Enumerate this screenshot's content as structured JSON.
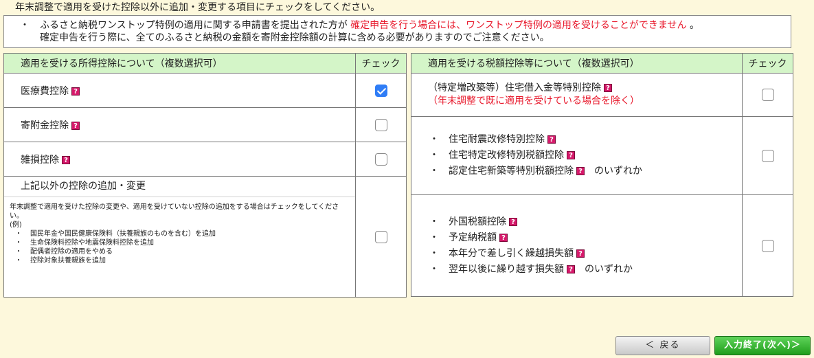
{
  "instruction": "年末調整で適用を受けた控除以外に追加・変更する項目にチェックをしてください。",
  "notice": {
    "bullet": "・",
    "line1_pre": "ふるさと納税ワンストップ特例の適用に関する申請書を提出された方が",
    "line1_red": "確定申告を行う場合には、ワンストップ特例の適用を受けることができません",
    "line1_post": "。",
    "line2": "確定申告を行う際に、全てのふるさと納税の金額を寄附金控除額の計算に含める必要がありますのでご注意ください。"
  },
  "help_glyph": "?",
  "left_table": {
    "header_label": "適用を受ける所得控除について（複数選択可）",
    "header_check": "チェック",
    "rows": [
      {
        "label": "医療費控除",
        "checked": true
      },
      {
        "label": "寄附金控除",
        "checked": false
      },
      {
        "label": "雑損控除",
        "checked": false
      }
    ],
    "other": {
      "title": "上記以外の控除の追加・変更",
      "desc": "年末調整で適用を受けた控除の変更や、適用を受けていない控除の追加をする場合はチェックをしてください。",
      "example_label": "(例)",
      "examples": [
        "国民年金や国民健康保険料（扶養親族のものを含む）を追加",
        "生命保険料控除や地震保険料控除を追加",
        "配偶者控除の適用をやめる",
        "控除対象扶養親族を追加"
      ],
      "checked": false
    }
  },
  "right_table": {
    "header_label": "適用を受ける税額控除等について（複数選択可）",
    "header_check": "チェック",
    "row1": {
      "label": "（特定増改築等）住宅借入金等特別控除",
      "note": "（年末調整で既に適用を受けている場合を除く）",
      "checked": false
    },
    "row2": {
      "items": [
        "住宅耐震改修特別控除",
        "住宅特定改修特別税額控除",
        "認定住宅新築等特別税額控除"
      ],
      "suffix": "のいずれか",
      "checked": false
    },
    "row3": {
      "items": [
        "外国税額控除",
        "予定納税額",
        "本年分で差し引く繰越損失額",
        "翌年以後に繰り越す損失額"
      ],
      "suffix": "のいずれか",
      "checked": false
    }
  },
  "buttons": {
    "back": "＜ 戻る",
    "next": "入力終了(次へ)＞"
  },
  "colors": {
    "background": "#fdf8dc",
    "header_bg": "#d4f5c8",
    "accent_red": "#e8182b",
    "help_icon": "#d6186a",
    "checkbox_checked": "#2f7df6",
    "next_button": "#1f9e1b"
  }
}
